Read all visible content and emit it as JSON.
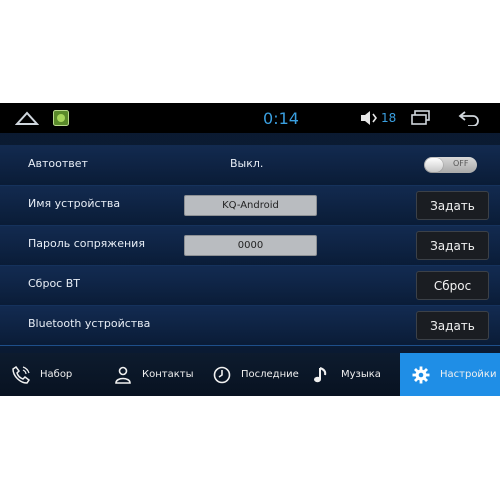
{
  "status_bar": {
    "time": "0:14",
    "volume_level": "18",
    "icons": [
      "home-icon",
      "app-thumbnail-icon",
      "volume-icon",
      "recent-apps-icon",
      "back-icon"
    ]
  },
  "settings": {
    "auto_answer": {
      "label": "Автоответ",
      "value": "Выкл.",
      "toggle_text": "OFF",
      "toggle_on": false
    },
    "device_name": {
      "label": "Имя устройства",
      "value": "KQ-Android",
      "button": "Задать"
    },
    "pairing_password": {
      "label": "Пароль сопряжения",
      "value": "0000",
      "button": "Задать"
    },
    "bt_reset": {
      "label": "Сброс BT",
      "button": "Сброс"
    },
    "bt_devices": {
      "label": "Bluetooth устройства",
      "button": "Задать"
    }
  },
  "bottom_nav": {
    "active": "settings",
    "accent_color": "#1f8ee6",
    "items": [
      {
        "id": "dial",
        "label": "Набор",
        "icon": "phone-icon"
      },
      {
        "id": "contacts",
        "label": "Контакты",
        "icon": "person-icon"
      },
      {
        "id": "recent",
        "label": "Последние",
        "icon": "clock-icon"
      },
      {
        "id": "music",
        "label": "Музыка",
        "icon": "music-note-icon"
      },
      {
        "id": "settings",
        "label": "Настройки",
        "icon": "gear-icon"
      }
    ]
  }
}
